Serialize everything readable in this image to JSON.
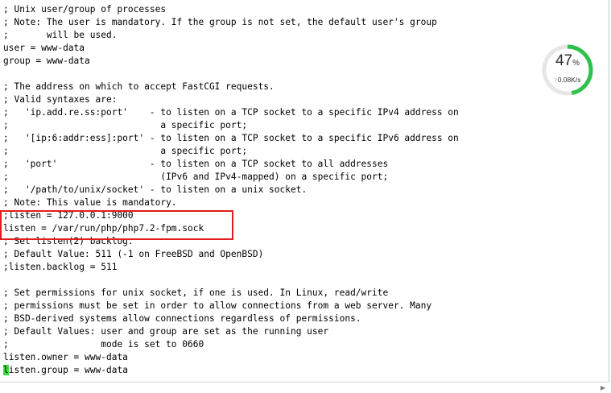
{
  "editor": {
    "lines": [
      "; Unix user/group of processes",
      "; Note: The user is mandatory. If the group is not set, the default user's group",
      ";       will be used.",
      "user = www-data",
      "group = www-data",
      "",
      "; The address on which to accept FastCGI requests.",
      "; Valid syntaxes are:",
      ";   'ip.add.re.ss:port'    - to listen on a TCP socket to a specific IPv4 address on",
      ";                            a specific port;",
      ";   '[ip:6:addr:ess]:port' - to listen on a TCP socket to a specific IPv6 address on",
      ";                            a specific port;",
      ";   'port'                 - to listen on a TCP socket to all addresses",
      ";                            (IPv6 and IPv4-mapped) on a specific port;",
      ";   '/path/to/unix/socket' - to listen on a unix socket.",
      "; Note: This value is mandatory.",
      ";listen = 127.0.0.1:9000",
      "listen = /var/run/php/php7.2-fpm.sock",
      "; Set listen(2) backlog.",
      "; Default Value: 511 (-1 on FreeBSD and OpenBSD)",
      ";listen.backlog = 511",
      "",
      "; Set permissions for unix socket, if one is used. In Linux, read/write",
      "; permissions must be set in order to allow connections from a web server. Many",
      "; BSD-derived systems allow connections regardless of permissions.",
      "; Default Values: user and group are set as the running user",
      ";                 mode is set to 0660",
      "listen.owner = www-data"
    ],
    "cursor_char": "l",
    "last_line_rest": "isten.group = www-data"
  },
  "gauge": {
    "percent": "47",
    "percent_symbol": "%",
    "percent_value": 0.47,
    "speed_arrow": "↑",
    "speed": "0.08K/s",
    "color_ring": "#2fc24a",
    "color_track": "#e6e6e6"
  },
  "colors": {
    "highlight_box": "#e51c1c",
    "cursor": "#3cdc3c"
  }
}
